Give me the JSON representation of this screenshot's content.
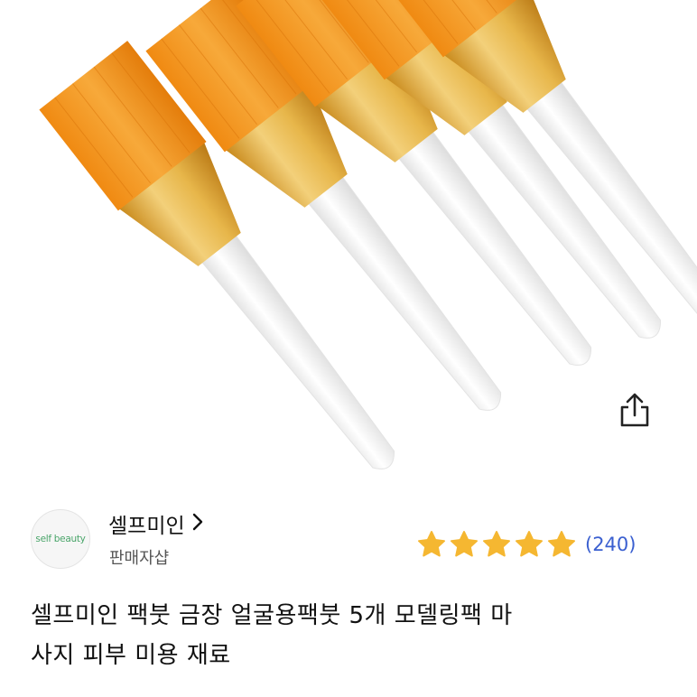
{
  "product": {
    "image_alt": "팩붓 5개",
    "title_line1": "셀프미인 팩붓 금장 얼굴용팩붓 5개 모델링팩 마",
    "title_line2": "사지 피부 미용 재료"
  },
  "share": {
    "icon": "share-icon"
  },
  "seller": {
    "avatar_text_main": "self beauty",
    "name": "셀프미인",
    "type": "판매자샵",
    "chevron_icon": "chevron-right-icon"
  },
  "rating": {
    "stars": 5,
    "review_count": "(240)",
    "star_color": "#f5b731"
  },
  "colors": {
    "bristle": "#f29a1f",
    "ferrule": "#e7b64a",
    "handle": "#f4f4f4",
    "link": "#3a5fd0"
  }
}
